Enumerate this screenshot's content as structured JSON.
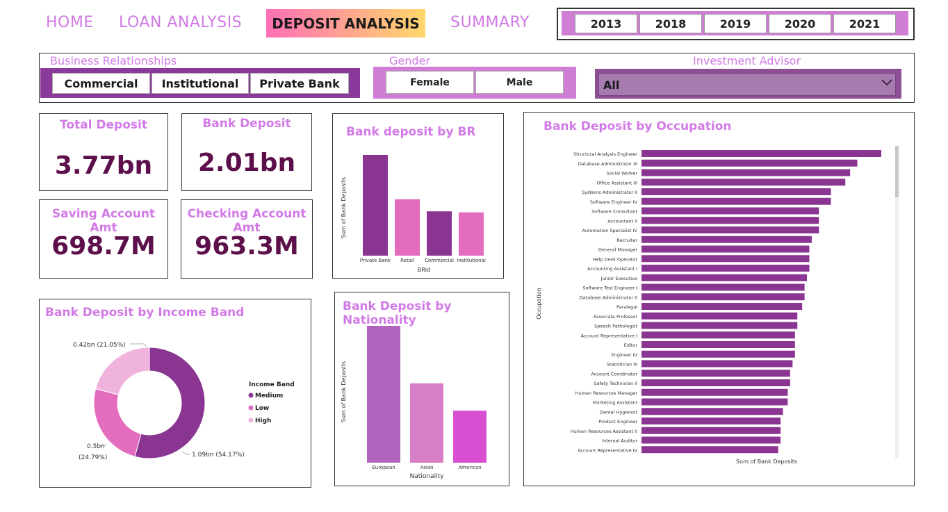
{
  "nav": {
    "home": "HOME",
    "loan": "LOAN ANALYSIS",
    "deposit": "DEPOSIT ANALYSIS",
    "summary": "SUMMARY"
  },
  "years": [
    "2013",
    "2018",
    "2019",
    "2020",
    "2021"
  ],
  "slicers": {
    "business_title": "Business Relationships",
    "business_options": [
      "Commercial",
      "Institutional",
      "Private Bank"
    ],
    "gender_title": "Gender",
    "gender_options": [
      "Female",
      "Male"
    ],
    "advisor_title": "Investment Advisor",
    "advisor_value": "All"
  },
  "kpis": {
    "total_deposit_label": "Total Deposit",
    "total_deposit_value": "3.77bn",
    "bank_deposit_label": "Bank Deposit",
    "bank_deposit_value": "2.01bn",
    "saving_label": "Saving Account Amt",
    "saving_value": "698.7M",
    "checking_label": "Checking Account Amt",
    "checking_value": "963.3M"
  },
  "colors": {
    "accent": "#d27ae6",
    "kpi_value": "#5c0f4a",
    "dark_purple": "#8a3591",
    "pink": "#e36cbf",
    "light_pink": "#f0b3dc"
  },
  "chart_data": [
    {
      "type": "bar",
      "title": "Bank deposit by BR",
      "xlabel": "BRId",
      "ylabel": "Sum of Bank Deposits",
      "categories": [
        "Private Bank",
        "Retail",
        "Commercial",
        "Institutional"
      ],
      "values": [
        1.0,
        0.56,
        0.44,
        0.43
      ],
      "colors": [
        "#8a3591",
        "#e36cbf",
        "#8a3591",
        "#e36cbf"
      ]
    },
    {
      "type": "pie",
      "title": "Bank Deposit by Income Band",
      "legend_title": "Income Band",
      "legend_position": "right",
      "slices": [
        {
          "name": "Medium",
          "value": 1.09,
          "label": "1.09bn (54.17%)",
          "color": "#8a3591"
        },
        {
          "name": "Low",
          "value": 0.5,
          "label": "0.5bn",
          "label2": "(24.79%)",
          "color": "#e36cbf"
        },
        {
          "name": "High",
          "value": 0.42,
          "label": "0.42bn (21.05%)",
          "color": "#f0b3dc"
        }
      ]
    },
    {
      "type": "bar",
      "title": "Bank Deposit by Nationality",
      "xlabel": "Nationality",
      "ylabel": "Sum of Bank Deposits",
      "categories": [
        "European",
        "Asian",
        "American"
      ],
      "values": [
        1.0,
        0.58,
        0.38
      ],
      "colors": [
        "#b064be",
        "#d87ec6",
        "#d84fd2"
      ]
    },
    {
      "type": "bar",
      "orientation": "horizontal",
      "title": "Bank Deposit by Occupation",
      "xlabel": "Sum of Bank Deposits",
      "ylabel": "Occupation",
      "color": "#8a3591",
      "categories": [
        "Structural Analysis Engineer",
        "Database Administrator III",
        "Social Worker",
        "Office Assistant III",
        "Systems Administrator II",
        "Software Engineer IV",
        "Software Consultant",
        "Accountant II",
        "Automation Specialist IV",
        "Recruiter",
        "General Manager",
        "Help Desk Operator",
        "Accounting Assistant I",
        "Junior Executive",
        "Software Test Engineer I",
        "Database Administrator II",
        "Paralegal",
        "Associate Professor",
        "Speech Pathologist",
        "Account Representative I",
        "Editor",
        "Engineer IV",
        "Statistician III",
        "Account Coordinator",
        "Safety Technician II",
        "Human Resources Manager",
        "Marketing Assistant",
        "Dental Hygienist",
        "Product Engineer",
        "Human Resources Assistant II",
        "Internal Auditor",
        "Account Representative IV"
      ],
      "values": [
        100,
        90,
        87,
        85,
        79,
        79,
        74,
        74,
        74,
        71,
        70,
        70,
        70,
        69,
        68,
        68,
        67,
        65,
        65,
        64,
        64,
        64,
        63,
        62,
        62,
        61,
        61,
        59,
        58,
        58,
        58,
        57
      ]
    }
  ]
}
